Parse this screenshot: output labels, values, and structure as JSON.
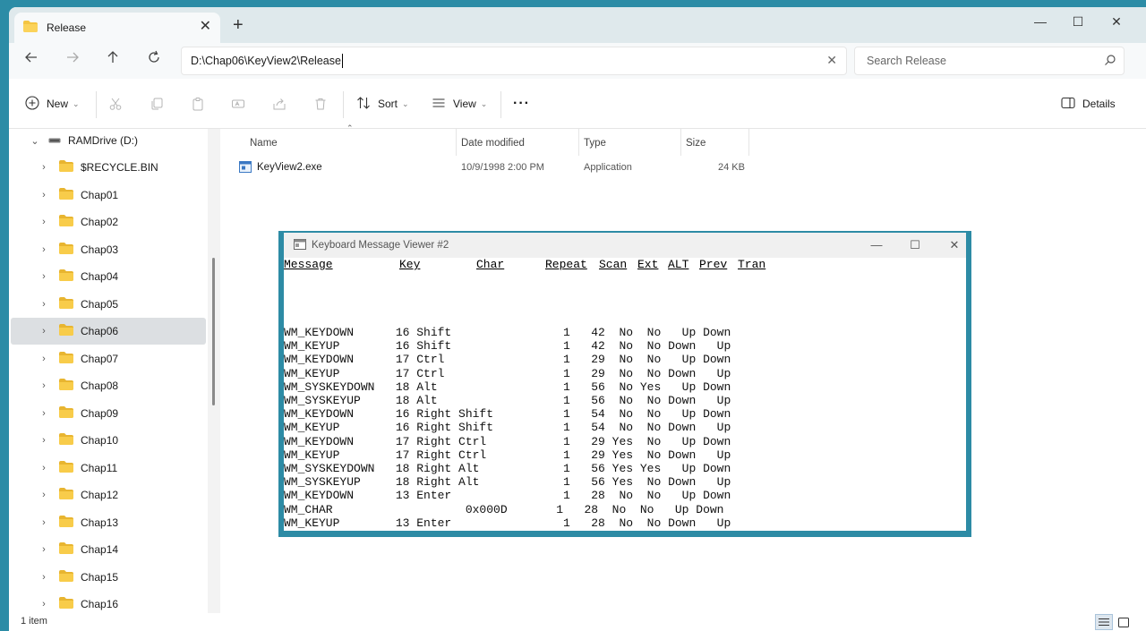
{
  "explorer": {
    "tab_title": "Release",
    "address": "D:\\Chap06\\KeyView2\\Release",
    "search_placeholder": "Search Release",
    "toolbar": {
      "new_label": "New",
      "sort_label": "Sort",
      "view_label": "View",
      "more_label": "···",
      "details_label": "Details"
    },
    "tree": {
      "drive_label": "RAMDrive (D:)",
      "items": [
        {
          "label": "$RECYCLE.BIN"
        },
        {
          "label": "Chap01"
        },
        {
          "label": "Chap02"
        },
        {
          "label": "Chap03"
        },
        {
          "label": "Chap04"
        },
        {
          "label": "Chap05"
        },
        {
          "label": "Chap06",
          "selected": true
        },
        {
          "label": "Chap07"
        },
        {
          "label": "Chap08"
        },
        {
          "label": "Chap09"
        },
        {
          "label": "Chap10"
        },
        {
          "label": "Chap11"
        },
        {
          "label": "Chap12"
        },
        {
          "label": "Chap13"
        },
        {
          "label": "Chap14"
        },
        {
          "label": "Chap15"
        },
        {
          "label": "Chap16"
        }
      ]
    },
    "columns": {
      "name": "Name",
      "date": "Date modified",
      "type": "Type",
      "size": "Size"
    },
    "files": [
      {
        "name": "KeyView2.exe",
        "date": "10/9/1998 2:00 PM",
        "type": "Application",
        "size": "24 KB"
      }
    ],
    "status": "1 item",
    "colors": {
      "desktop": "#2c8ca6",
      "titlebar": "#dfe9ec",
      "folder": "#f4c542",
      "selection": "#dcdfe2"
    }
  },
  "kmv": {
    "title": "Keyboard Message Viewer #2",
    "headers": {
      "message": "Message",
      "key": "Key",
      "char": "Char",
      "repeat": "Repeat",
      "scan": "Scan",
      "ext": "Ext",
      "alt": "ALT",
      "prev": "Prev",
      "tran": "Tran"
    },
    "lines": [
      "WM_KEYDOWN      16 Shift                1   42  No  No   Up Down",
      "WM_KEYUP        16 Shift                1   42  No  No Down   Up",
      "WM_KEYDOWN      17 Ctrl                 1   29  No  No   Up Down",
      "WM_KEYUP        17 Ctrl                 1   29  No  No Down   Up",
      "WM_SYSKEYDOWN   18 Alt                  1   56  No Yes   Up Down",
      "WM_SYSKEYUP     18 Alt                  1   56  No  No Down   Up",
      "WM_KEYDOWN      16 Right Shift          1   54  No  No   Up Down",
      "WM_KEYUP        16 Right Shift          1   54  No  No Down   Up",
      "WM_KEYDOWN      17 Right Ctrl           1   29 Yes  No   Up Down",
      "WM_KEYUP        17 Right Ctrl           1   29 Yes  No Down   Up",
      "WM_SYSKEYDOWN   18 Right Alt            1   56 Yes Yes   Up Down",
      "WM_SYSKEYUP     18 Right Alt            1   56 Yes  No Down   Up",
      "WM_KEYDOWN      13 Enter                1   28  No  No   Up Down",
      "WM_CHAR                   0x000D       1   28  No  No   Up Down",
      "WM_KEYUP        13 Enter                1   28  No  No Down   Up"
    ]
  }
}
